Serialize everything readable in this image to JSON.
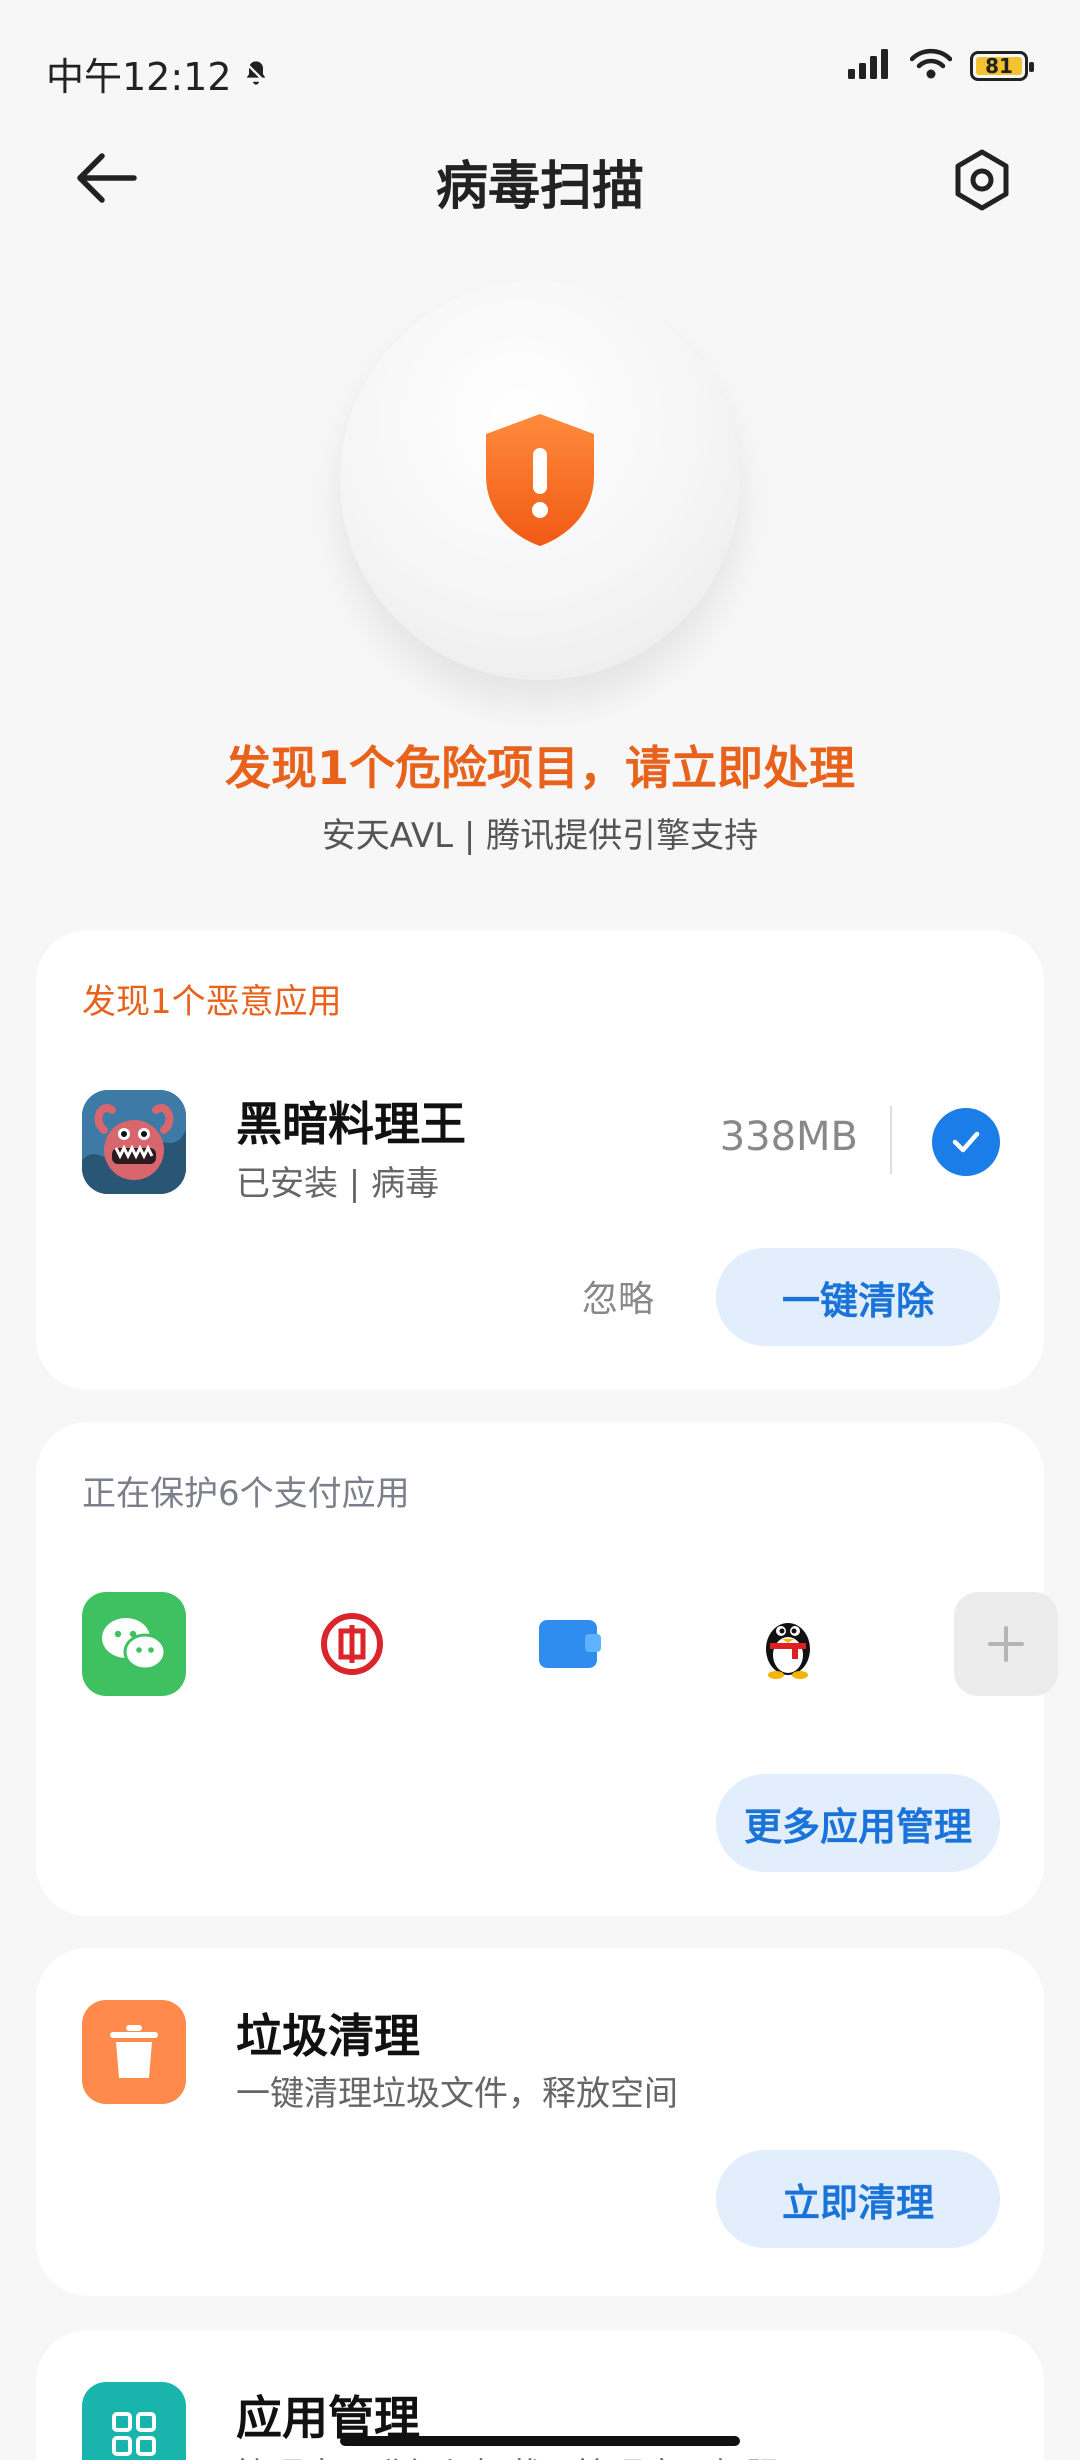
{
  "status_bar": {
    "time": "中午12:12",
    "battery": "81",
    "icons": [
      "notification-bell-icon",
      "signal-icon",
      "wifi-icon",
      "battery-icon"
    ]
  },
  "header": {
    "title": "病毒扫描"
  },
  "hero": {
    "title": "发现1个危险项目，请立即处理",
    "subtitle": "安天AVL | 腾讯提供引擎支持",
    "accent_color": "#e8621c"
  },
  "malicious_card": {
    "heading": "发现1个恶意应用",
    "app": {
      "name": "黑暗料理王",
      "meta": "已安装 | 病毒",
      "size": "338MB",
      "selected": true
    },
    "ignore_label": "忽略",
    "clean_label": "一键清除"
  },
  "payment_card": {
    "heading": "正在保护6个支付应用",
    "apps": [
      "wechat-icon",
      "icbc-bank-icon",
      "wallet-icon",
      "qq-penguin-icon",
      "add-icon"
    ],
    "more_label": "更多应用管理"
  },
  "junk_card": {
    "title": "垃圾清理",
    "subtitle": "一键清理垃圾文件，释放空间",
    "action_label": "立即清理"
  },
  "app_manage_card": {
    "title": "应用管理",
    "subtitle": "管理应用升级与卸载，管理应用权限"
  },
  "colors": {
    "primary_blue": "#1a73d9",
    "pill_bg": "#e2eefb",
    "warning_orange": "#e8621c"
  }
}
